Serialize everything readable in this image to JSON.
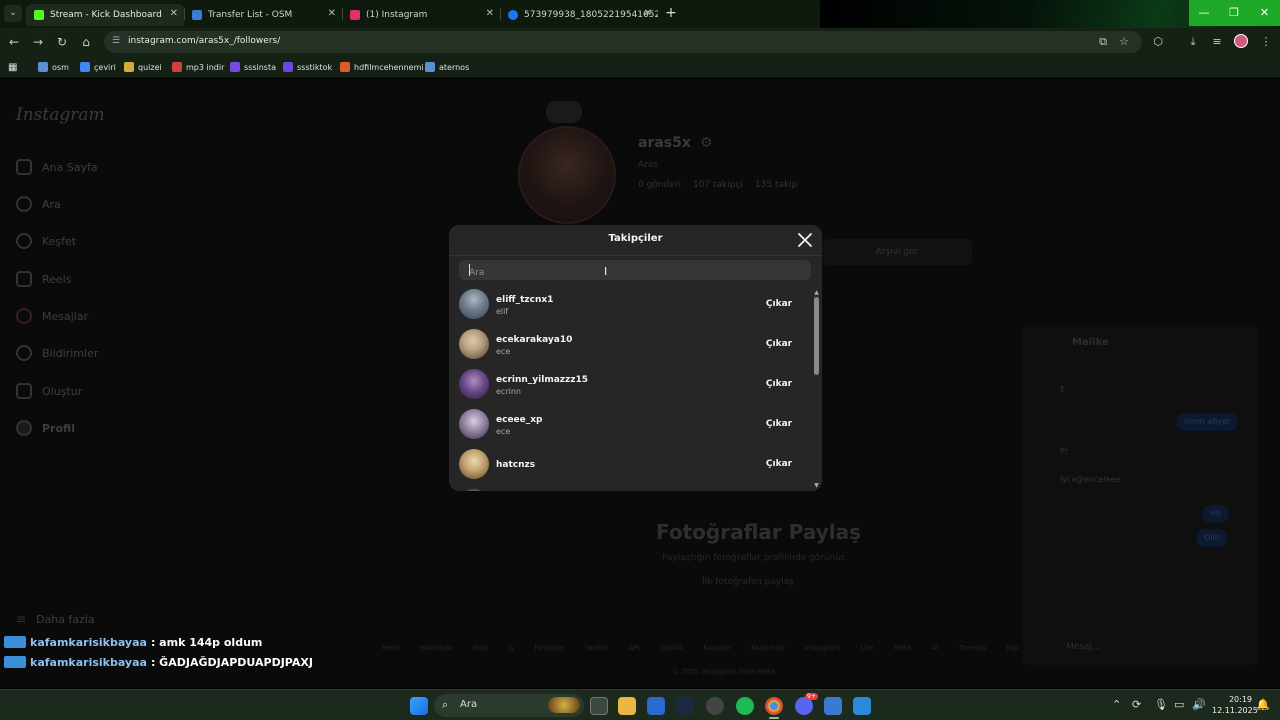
{
  "browser": {
    "tabs": [
      {
        "title": "Stream - Kick Dashboard",
        "favicon_color": "#53fc18",
        "active": true
      },
      {
        "title": "Transfer List - OSM",
        "favicon_color": "#3a7bd5",
        "active": false
      },
      {
        "title": "(1) Instagram",
        "favicon_color": "#e1306c",
        "active": false
      },
      {
        "title": "573979938_1805221954165266",
        "favicon_color": "#1877f2",
        "active": false
      }
    ],
    "url": "instagram.com/aras5x_/followers/",
    "bookmarks": [
      {
        "label": "osm",
        "color": "#5a8fd8"
      },
      {
        "label": "çeviri",
        "color": "#4285f4"
      },
      {
        "label": "quizei",
        "color": "#cfae3a"
      },
      {
        "label": "mp3 indir",
        "color": "#d04040"
      },
      {
        "label": "sssinsta",
        "color": "#7a4ae0"
      },
      {
        "label": "ssstiktok",
        "color": "#6a4ae0"
      },
      {
        "label": "hdfilmcehennemi",
        "color": "#e05a2a"
      },
      {
        "label": "aternos",
        "color": "#5a8fd8"
      }
    ]
  },
  "instagram": {
    "logo": "Instagram",
    "nav": [
      {
        "label": "Ana Sayfa",
        "icon": "home-icon"
      },
      {
        "label": "Ara",
        "icon": "search-icon"
      },
      {
        "label": "Keşfet",
        "icon": "compass-icon"
      },
      {
        "label": "Reels",
        "icon": "reels-icon"
      },
      {
        "label": "Mesajlar",
        "icon": "messenger-icon"
      },
      {
        "label": "Bildirimler",
        "icon": "heart-icon"
      },
      {
        "label": "Oluştur",
        "icon": "plus-icon"
      },
      {
        "label": "Profil",
        "icon": "avatar-icon"
      }
    ],
    "more": "Daha fazla",
    "profile": {
      "username": "aras5x",
      "name": "Aras",
      "posts": "0 gönderi",
      "followers": "107 takipçi",
      "following": "135 takip",
      "archive_button": "Arşivi gör"
    },
    "empty": {
      "title": "Fotoğraflar Paylaş",
      "subtitle": "Paylaştığın fotoğraflar profilinde görünür.",
      "link": "İlk fotoğrafını paylaş"
    },
    "footer_links": "Meta Hakkında Blog İş Fırsatları Yardım API Gizlilik Koşullar Konumlar Instagram Lite Meta AI Threads Kişi Yükleme ve Hesap Dışı Kullanıcılar",
    "footer_copy": "© 2025 Instagram from Meta",
    "chat": {
      "name": "Melike",
      "messages": [
        "E",
        "Pt",
        "Iyi eğlenceleee"
      ],
      "my_messages": [
        "ümm afiyet",
        "Hb",
        "Ollll"
      ],
      "input_placeholder": "Mesaj..."
    }
  },
  "modal": {
    "title": "Takipçiler",
    "search_placeholder": "Ara",
    "remove_label": "Çıkar",
    "followers": [
      {
        "username": "eliff_tzcnx1",
        "name": "elif",
        "avatar_color": "#6a7a8a"
      },
      {
        "username": "ecekarakaya10",
        "name": "ece",
        "avatar_color": "#b8a080"
      },
      {
        "username": "ecrinn_yilmazzz15",
        "name": "ecrinn",
        "avatar_color": "#6a4a8a"
      },
      {
        "username": "eceee_xp",
        "name": "ece",
        "avatar_color": "#8a7a9a"
      },
      {
        "username": "hatcnzs",
        "name": "",
        "avatar_color": "#c0a070"
      }
    ]
  },
  "stream_chat": [
    {
      "user": "kafamkarisikbayaa",
      "message": ": amk 144p oldum"
    },
    {
      "user": "kafamkarisikbayaa",
      "message": ": ĞADJAĞDJAPDUAPDJPAXJ"
    }
  ],
  "taskbar": {
    "search_label": "Ara",
    "time": "20:19",
    "date": "12.11.2025",
    "discord_badge": "9+"
  }
}
